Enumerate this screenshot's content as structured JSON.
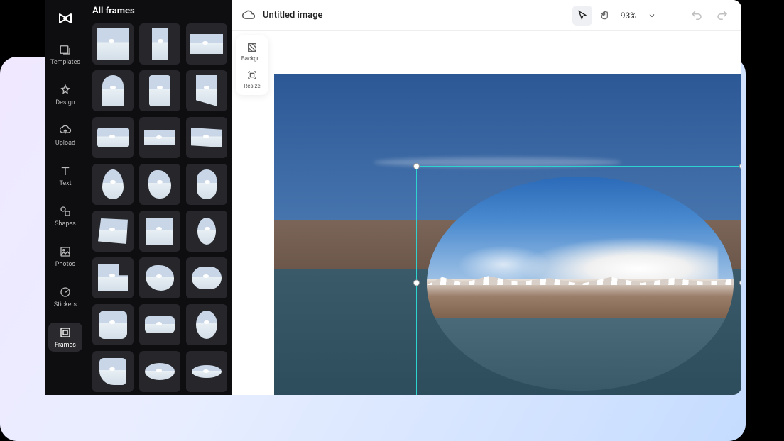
{
  "header": {
    "title": "Untitled image",
    "zoom": "93%"
  },
  "nav": {
    "items": [
      {
        "label": "Templates",
        "icon": "templates-icon"
      },
      {
        "label": "Design",
        "icon": "design-icon"
      },
      {
        "label": "Upload",
        "icon": "upload-icon"
      },
      {
        "label": "Text",
        "icon": "text-icon"
      },
      {
        "label": "Shapes",
        "icon": "shapes-icon"
      },
      {
        "label": "Photos",
        "icon": "photos-icon"
      },
      {
        "label": "Stickers",
        "icon": "stickers-icon"
      },
      {
        "label": "Frames",
        "icon": "frames-icon",
        "active": true
      }
    ]
  },
  "frames_panel": {
    "title": "All frames"
  },
  "side_tools": {
    "background": "Backgr...",
    "resize": "Resize"
  }
}
